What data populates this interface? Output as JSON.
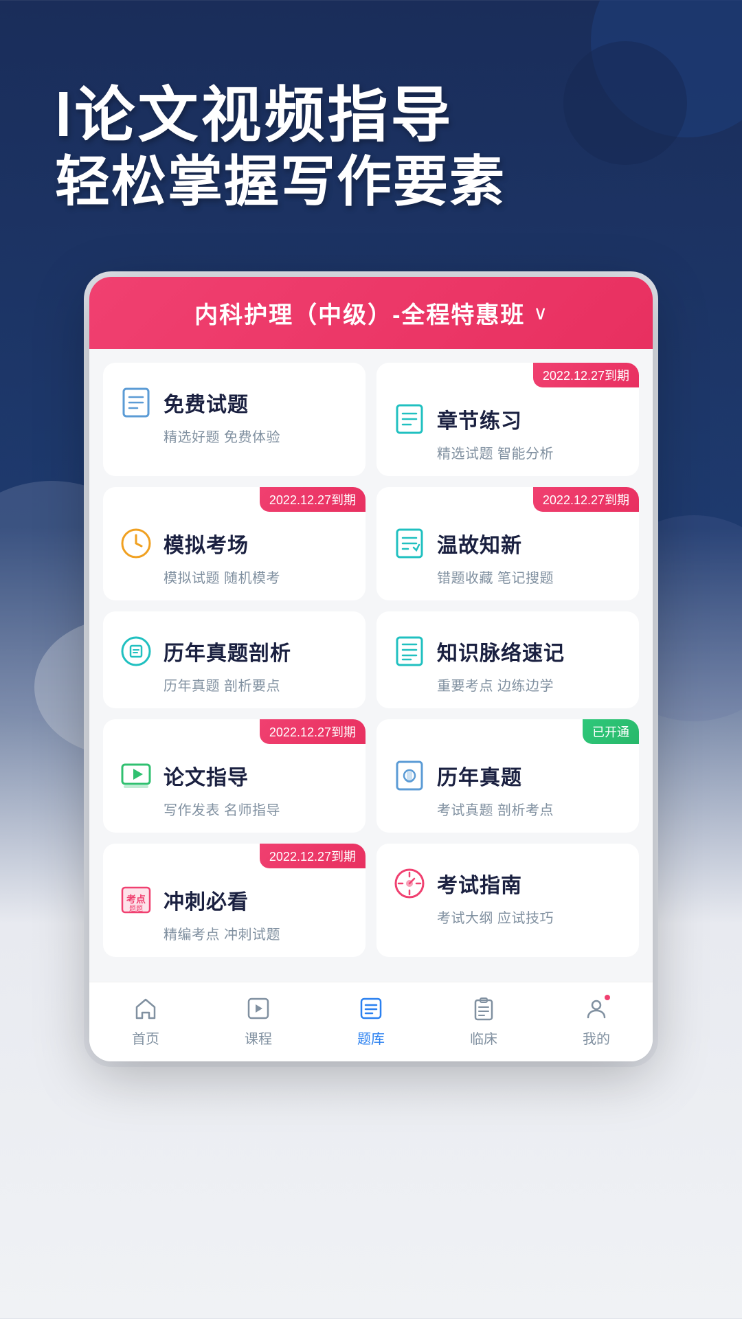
{
  "hero": {
    "line1": "l论文视频指导",
    "line2": "轻松掌握写作要素"
  },
  "course": {
    "title": "内科护理（中级）-全程特惠班",
    "dropdown": "∨"
  },
  "cards": [
    {
      "id": "free-questions",
      "title": "免费试题",
      "subtitle": "精选好题 免费体验",
      "badge": null,
      "icon": "document-blue"
    },
    {
      "id": "chapter-practice",
      "title": "章节练习",
      "subtitle": "精选试题 智能分析",
      "badge": "2022.12.27到期",
      "badge_type": "red",
      "icon": "document-teal"
    },
    {
      "id": "mock-exam",
      "title": "模拟考场",
      "subtitle": "模拟试题 随机模考",
      "badge": "2022.12.27到期",
      "badge_type": "red",
      "icon": "clock-orange"
    },
    {
      "id": "review",
      "title": "温故知新",
      "subtitle": "错题收藏 笔记搜题",
      "badge": "2022.12.27到期",
      "badge_type": "red",
      "icon": "document-edit-teal"
    },
    {
      "id": "past-analysis",
      "title": "历年真题剖析",
      "subtitle": "历年真题 剖析要点",
      "badge": null,
      "icon": "circle-doc-teal"
    },
    {
      "id": "knowledge-map",
      "title": "知识脉络速记",
      "subtitle": "重要考点 边练边学",
      "badge": null,
      "icon": "list-teal"
    },
    {
      "id": "thesis-guide",
      "title": "论文指导",
      "subtitle": "写作发表 名师指导",
      "badge": "2022.12.27到期",
      "badge_type": "red",
      "icon": "video-green"
    },
    {
      "id": "past-papers",
      "title": "历年真题",
      "subtitle": "考试真题 剖析考点",
      "badge": "已开通",
      "badge_type": "green",
      "icon": "lock-doc-blue"
    },
    {
      "id": "sprint",
      "title": "冲刺必看",
      "subtitle": "精编考点 冲刺试题",
      "badge": "2022.12.27到期",
      "badge_type": "red",
      "icon": "kaodian-red"
    },
    {
      "id": "exam-guide",
      "title": "考试指南",
      "subtitle": "考试大纲 应试技巧",
      "badge": null,
      "icon": "compass-pink"
    }
  ],
  "bottomNav": [
    {
      "id": "home",
      "label": "首页",
      "active": false,
      "icon": "home-icon"
    },
    {
      "id": "course",
      "label": "课程",
      "active": false,
      "icon": "play-icon"
    },
    {
      "id": "questionbank",
      "label": "题库",
      "active": true,
      "icon": "list-icon"
    },
    {
      "id": "clinical",
      "label": "临床",
      "active": false,
      "icon": "clipboard-icon"
    },
    {
      "id": "mine",
      "label": "我的",
      "active": false,
      "icon": "user-icon"
    }
  ]
}
